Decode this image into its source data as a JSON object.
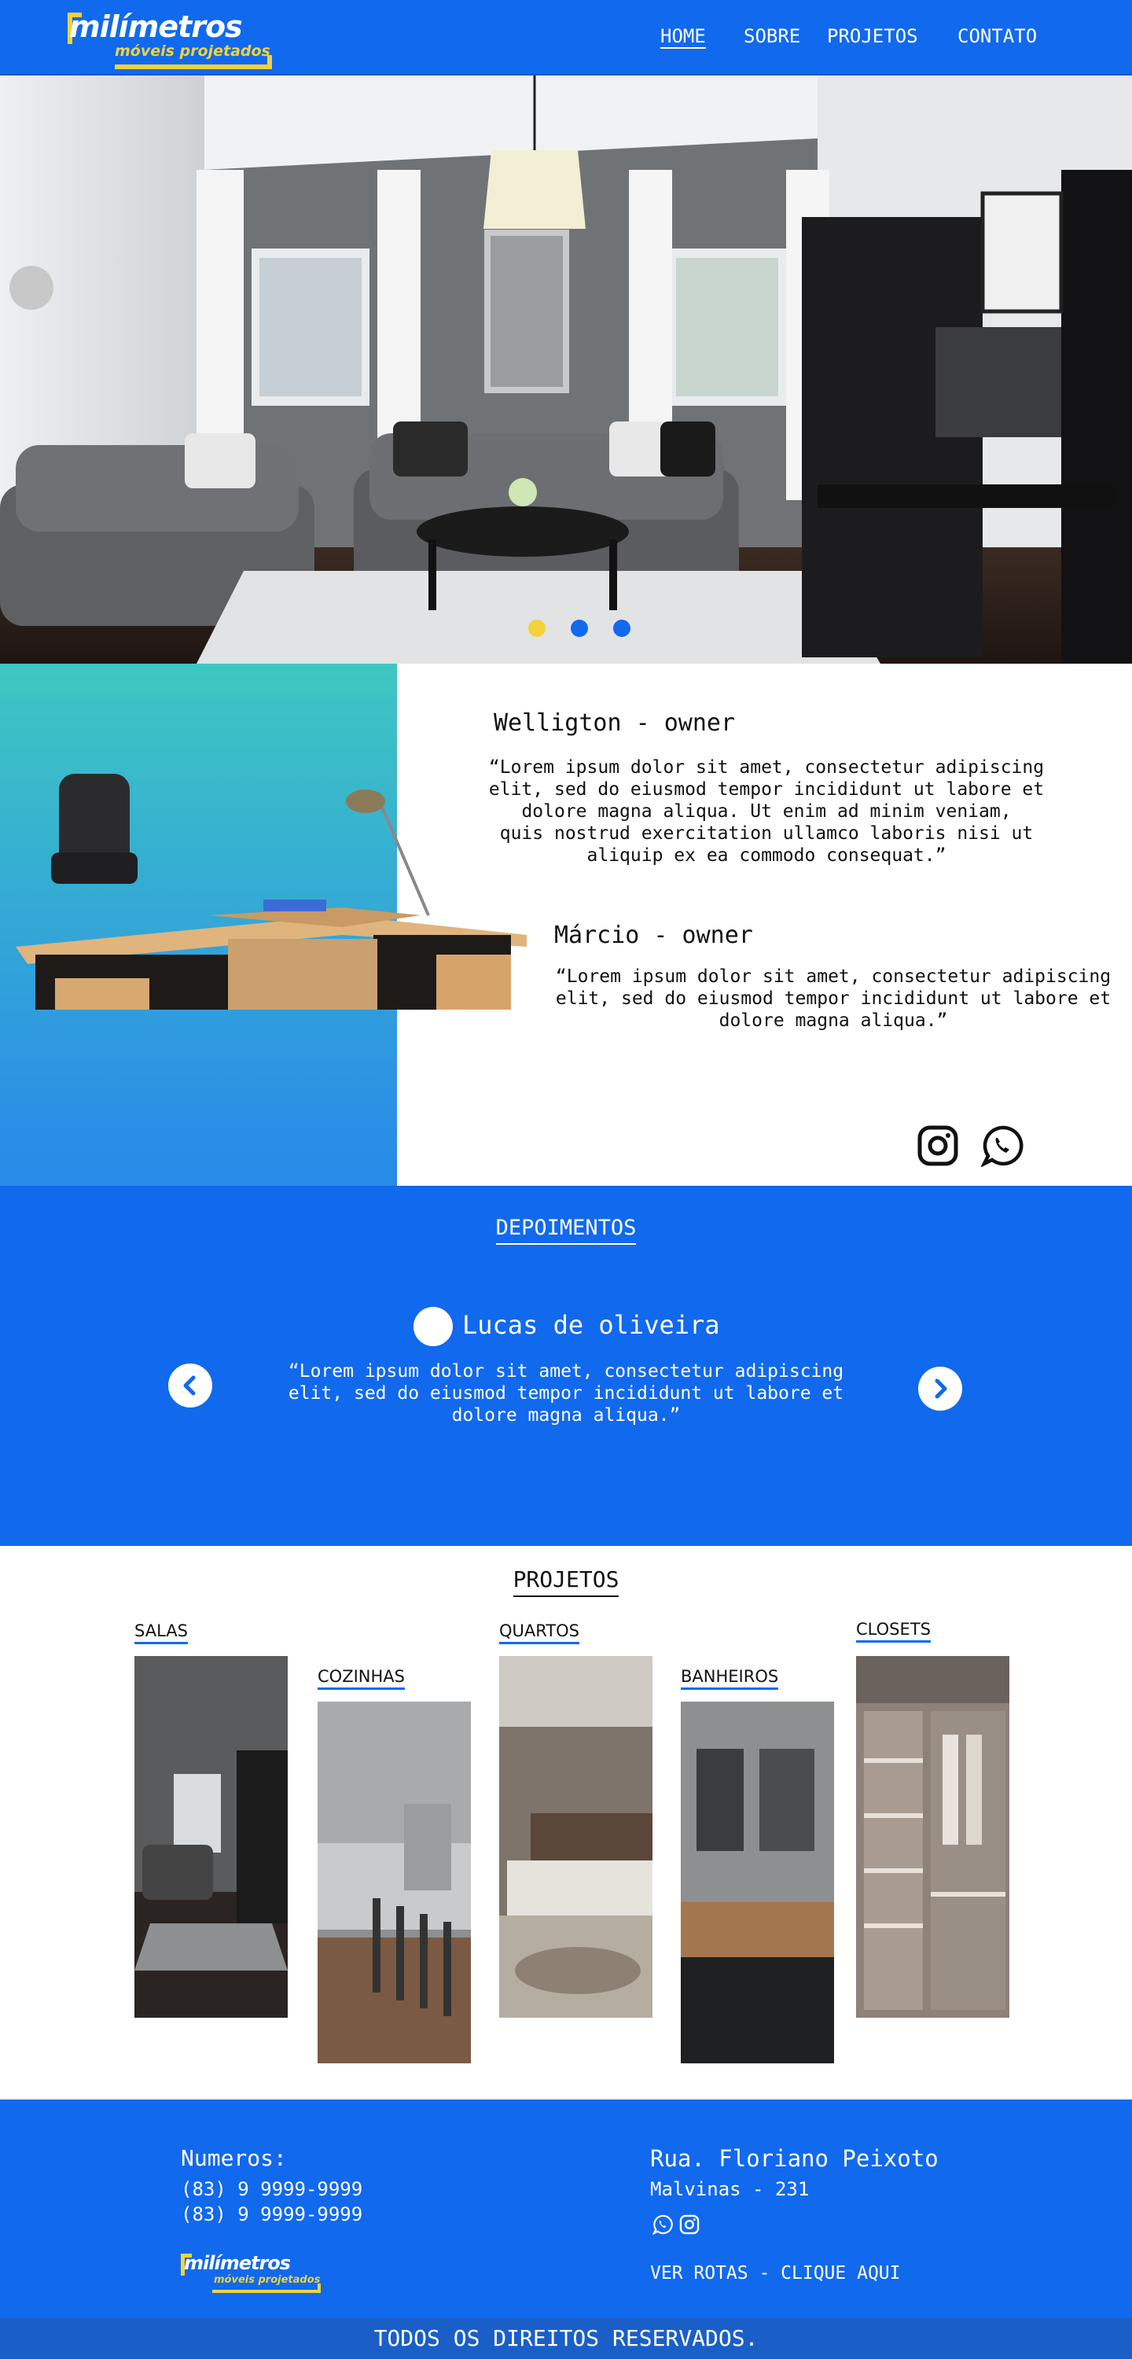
{
  "header": {
    "logo_line1": "milímetros",
    "logo_line2": "móveis projetados",
    "nav": [
      {
        "label": "HOME"
      },
      {
        "label": "SOBRE"
      },
      {
        "label": "PROJETOS"
      },
      {
        "label": "CONTATO"
      }
    ]
  },
  "colors": {
    "brand_blue": "#1169ee",
    "brand_yellow": "#f2d33b",
    "copyright_bar": "#1a5fc8"
  },
  "hero": {
    "carousel_dots": [
      "active",
      "inactive",
      "inactive"
    ]
  },
  "owners": [
    {
      "name": "Welligton - owner",
      "quote_lines": [
        "“Lorem ipsum dolor sit amet, consectetur adipiscing",
        "elit, sed do eiusmod tempor incididunt ut labore et",
        "dolore magna aliqua. Ut enim ad minim veniam,",
        "quis nostrud exercitation ullamco laboris nisi ut",
        "aliquip ex ea commodo consequat.”"
      ]
    },
    {
      "name": "Márcio - owner",
      "quote_lines": [
        "“Lorem ipsum dolor sit amet, consectetur adipiscing",
        "elit, sed do eiusmod tempor incididunt ut labore et",
        "dolore magna aliqua.”"
      ]
    }
  ],
  "social_icons": [
    "instagram-icon",
    "whatsapp-icon"
  ],
  "depoimentos": {
    "title": "DEPOIMENTOS",
    "name": "Lucas de oliveira",
    "quote_lines": [
      "“Lorem ipsum dolor sit amet, consectetur adipiscing",
      "elit, sed do eiusmod tempor incididunt ut labore et",
      "dolore magna aliqua.”"
    ]
  },
  "projetos": {
    "title": "PROJETOS",
    "categories": [
      {
        "label": "SALAS"
      },
      {
        "label": "COZINHAS"
      },
      {
        "label": "QUARTOS"
      },
      {
        "label": "BANHEIROS"
      },
      {
        "label": "CLOSETS"
      }
    ]
  },
  "footer": {
    "numbers_title": "Numeros:",
    "phone1": "(83) 9 9999-9999",
    "phone2": "(83) 9 9999-9999",
    "street": "Rua. Floriano Peixoto",
    "district": "Malvinas - 231",
    "routes_link": "VER ROTAS - CLIQUE AQUI",
    "logo_line1": "milímetros",
    "logo_line2": "móveis projetados",
    "copyright": "TODOS OS DIREITOS RESERVADOS."
  }
}
